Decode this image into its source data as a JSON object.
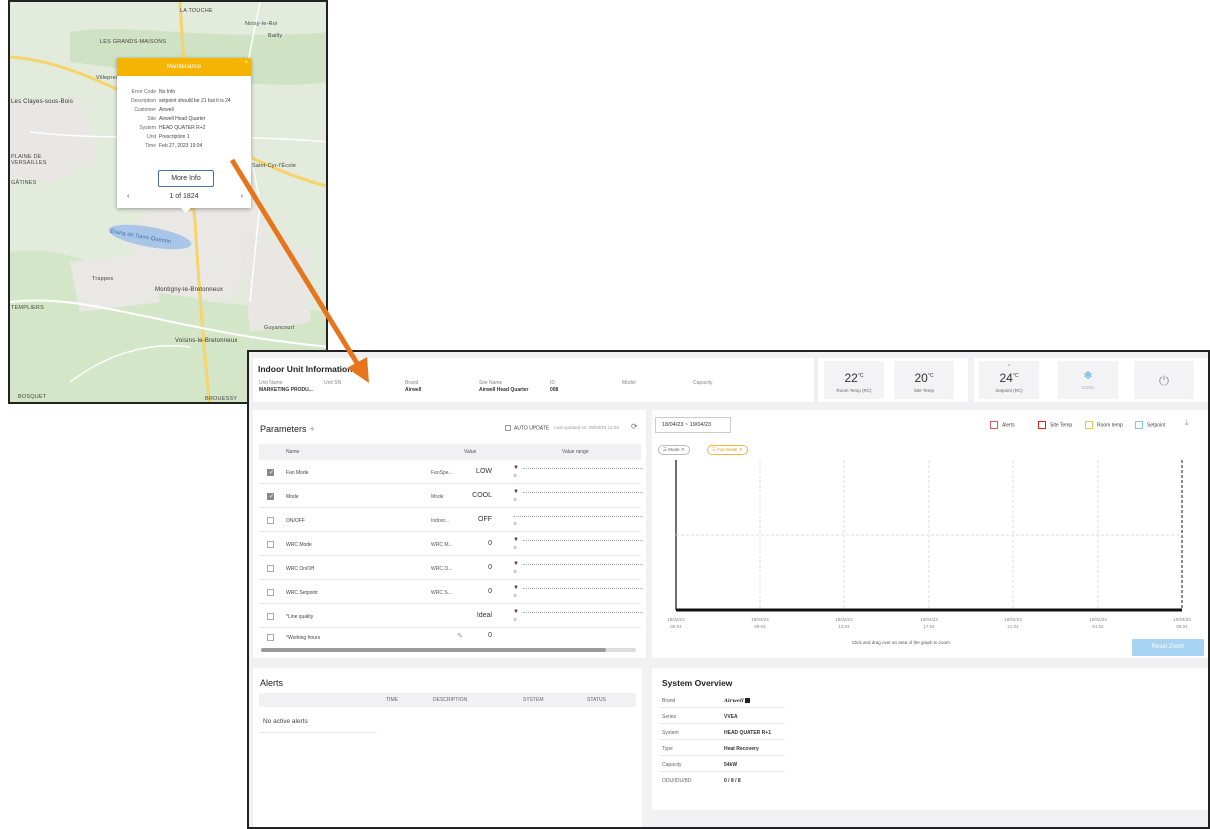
{
  "map": {
    "labels": [
      "LA TOUCHE",
      "Noisy-le-Roi",
      "Bailly",
      "LES GRANDS-MAISONS",
      "Villepreux",
      "Les Clayes-sous-Bois",
      "Saint-Cyr-l'École",
      "PLAINE DE VERSAILLES",
      "GÂTINES",
      "Étang de Saint-Quentin",
      "Trappes",
      "TEMPLIERS",
      "Montigny-le-Bretonneux",
      "Guyancourt",
      "Voisins-le-Bretonneux",
      "BOSQUET",
      "BROUESSY"
    ],
    "popup": {
      "title": "Maintenance",
      "close": "×",
      "rows": [
        {
          "k": "Error Code",
          "v": "No Info"
        },
        {
          "k": "Description",
          "v": "setpoint should be 21 but it is 24"
        },
        {
          "k": "Customer",
          "v": "Airwell"
        },
        {
          "k": "Site",
          "v": "Airwell Head Quarter"
        },
        {
          "k": "System",
          "v": "HEAD QUATER R+2"
        },
        {
          "k": "Unit",
          "v": "Prescription 1"
        },
        {
          "k": "Time",
          "v": "Feb 27, 2023 19:04"
        }
      ],
      "more_info": "More Info",
      "prev": "‹",
      "next": "›",
      "page": "1 of 1824"
    }
  },
  "info": {
    "title": "Indoor Unit Information",
    "cells": [
      {
        "label": "Unit Name",
        "value": "MARKETING PRODU..."
      },
      {
        "label": "Unit SN",
        "value": ""
      },
      {
        "label": "Brand",
        "value": "Airwell"
      },
      {
        "label": "Site Name",
        "value": "Airwell Head Quarter"
      },
      {
        "label": "ID",
        "value": "008"
      },
      {
        "label": "Model",
        "value": ""
      },
      {
        "label": "Capacity",
        "value": ""
      }
    ]
  },
  "stats": {
    "room_temp": {
      "value": "22",
      "unit": "°C",
      "label": "Room Temp (RC)"
    },
    "site_temp": {
      "value": "20",
      "unit": "°C",
      "label": "Site Temp"
    },
    "setpoint": {
      "value": "24",
      "unit": "°C",
      "label": "Setpoint (RC)"
    },
    "mode": {
      "icon": "snowflake-icon",
      "label": "COOL"
    },
    "power": {
      "icon": "power-icon"
    }
  },
  "params": {
    "title": "Parameters",
    "plus": "+",
    "auto_update": "AUTO UPDATE",
    "last_updated": "Last updated on: 09/03/23 12:03",
    "headers": {
      "name": "Name",
      "value": "Value",
      "range": "Value range"
    },
    "rows": [
      {
        "checked": true,
        "name": "Fan Mode",
        "src": "FanSpe...",
        "value": "LOW"
      },
      {
        "checked": true,
        "name": "Mode",
        "src": "Mode",
        "value": "COOL"
      },
      {
        "checked": false,
        "name": "ON/OFF",
        "src": "Indoor...",
        "value": "OFF"
      },
      {
        "checked": false,
        "name": "WRC Mode",
        "src": "WRC M...",
        "value": "0"
      },
      {
        "checked": false,
        "name": "WRC On/Off",
        "src": "WRC O...",
        "value": "0"
      },
      {
        "checked": false,
        "name": "WRC Setpoint",
        "src": "WRC S...",
        "value": "0"
      },
      {
        "checked": false,
        "name": "*Line quality",
        "src": "",
        "value": "Ideal"
      },
      {
        "checked": false,
        "name": "*Working hours",
        "src": "",
        "value": "0"
      }
    ],
    "range_zero": "0"
  },
  "chart": {
    "date_range": "18/04/23 ~ 19/04/23",
    "legend": [
      {
        "name": "Alerts",
        "color": "#e05a5a"
      },
      {
        "name": "Site Temp",
        "color": "#e02020"
      },
      {
        "name": "Room temp",
        "color": "#e8c84a"
      },
      {
        "name": "Setpoint",
        "color": "#7ec8f0"
      }
    ],
    "chips": [
      "Mode",
      "Fan Mode"
    ],
    "x_ticks": [
      [
        "18/04/23",
        "05:04"
      ],
      [
        "18/04/23",
        "09:04"
      ],
      [
        "18/04/23",
        "13:04"
      ],
      [
        "18/04/23",
        "17:04"
      ],
      [
        "18/04/23",
        "21:04"
      ],
      [
        "19/04/23",
        "01:04"
      ],
      [
        "19/04/23",
        "05:04"
      ]
    ],
    "zoom_hint": "Click and drag over an area of the graph to zoom",
    "reset_zoom": "Reset Zoom"
  },
  "alerts": {
    "title": "Alerts",
    "headers": [
      "TIME",
      "DESCRIPTION",
      "SYSTEM",
      "STATUS"
    ],
    "empty": "No active alerts"
  },
  "system": {
    "title": "System Overview",
    "rows": [
      {
        "k": "Brand",
        "v": "Airwell"
      },
      {
        "k": "Series",
        "v": "VVEA"
      },
      {
        "k": "System",
        "v": "HEAD QUATER R+1"
      },
      {
        "k": "Type",
        "v": "Heat Recovery"
      },
      {
        "k": "Capacity",
        "v": "54kW"
      },
      {
        "k": "ODU/IDU/BD",
        "v": "0 / 8 / 8"
      }
    ]
  },
  "colors": {
    "popup_header": "#f5b400",
    "arrow": "#e8741c",
    "accent_purple": "#5a2a6a"
  }
}
